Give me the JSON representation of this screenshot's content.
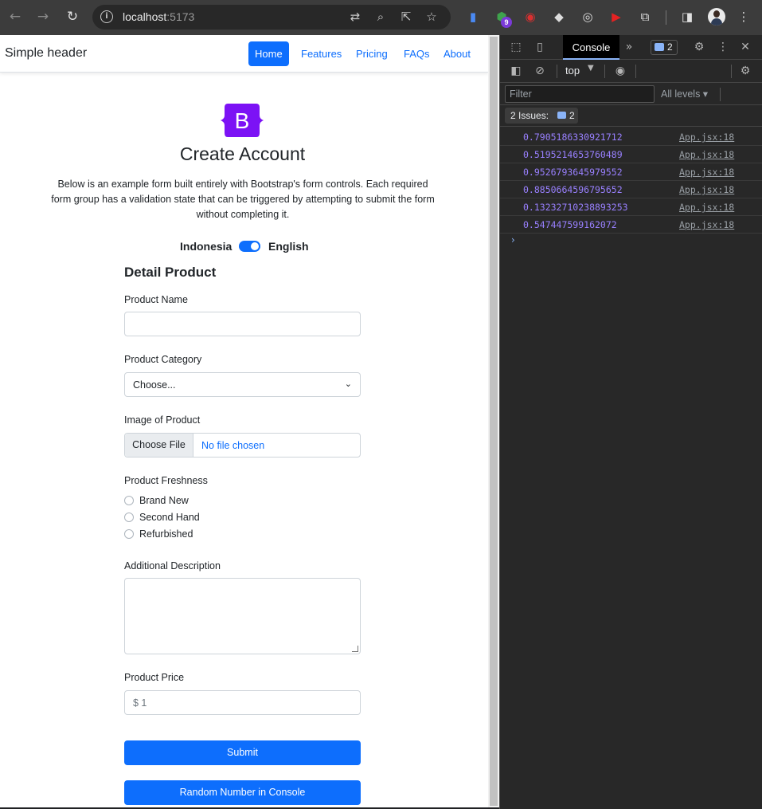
{
  "browser": {
    "url_host": "localhost",
    "url_port": ":5173",
    "extension_badge": "9",
    "icons": [
      "back-icon",
      "forward-icon",
      "reload-icon",
      "site-info-icon",
      "translate-icon",
      "zoom-icon",
      "share-icon",
      "bookmark-star-icon",
      "extensions-icon",
      "side-panel-icon",
      "profile-avatar",
      "menu-icon"
    ]
  },
  "header": {
    "brand": "Simple header",
    "nav": [
      {
        "label": "Home",
        "active": true
      },
      {
        "label": "Features",
        "active": false
      },
      {
        "label": "Pricing",
        "active": false
      },
      {
        "label": "FAQs",
        "active": false
      },
      {
        "label": "About",
        "active": false
      }
    ]
  },
  "hero": {
    "logo_letter": "B",
    "title": "Create Account",
    "lead": "Below is an example form built entirely with Bootstrap's form controls. Each required form group has a validation state that can be triggered by attempting to submit the form without completing it."
  },
  "language": {
    "left": "Indonesia",
    "right": "English",
    "toggle_on": true
  },
  "form": {
    "section_title": "Detail Product",
    "product_name_label": "Product Name",
    "product_name_value": "",
    "category_label": "Product Category",
    "category_selected": "Choose...",
    "image_label": "Image of Product",
    "file_button": "Choose File",
    "file_status": "No file chosen",
    "freshness_label": "Product Freshness",
    "freshness_options": [
      "Brand New",
      "Second Hand",
      "Refurbished"
    ],
    "description_label": "Additional Description",
    "price_label": "Product Price",
    "price_value": "$ 1",
    "submit_label": "Submit",
    "random_label": "Random Number in Console"
  },
  "devtools": {
    "tab_label": "Console",
    "issues_count": "2",
    "context": "top",
    "filter_placeholder": "Filter",
    "levels_label": "All levels",
    "issues_pill_label": "2 Issues:",
    "issues_pill_count": "2",
    "logs": [
      {
        "value": "0.7905186330921712",
        "source": "App.jsx:18"
      },
      {
        "value": "0.5195214653760489",
        "source": "App.jsx:18"
      },
      {
        "value": "0.9526793645979552",
        "source": "App.jsx:18"
      },
      {
        "value": "0.8850664596795652",
        "source": "App.jsx:18"
      },
      {
        "value": "0.13232710238893253",
        "source": "App.jsx:18"
      },
      {
        "value": "0.547447599162072",
        "source": "App.jsx:18"
      }
    ],
    "prompt": "›"
  },
  "colors": {
    "primary": "#0d6efd",
    "brand_purple": "#7c12f5",
    "console_number": "#9980ff",
    "chrome_dark": "#3c3c3c"
  }
}
